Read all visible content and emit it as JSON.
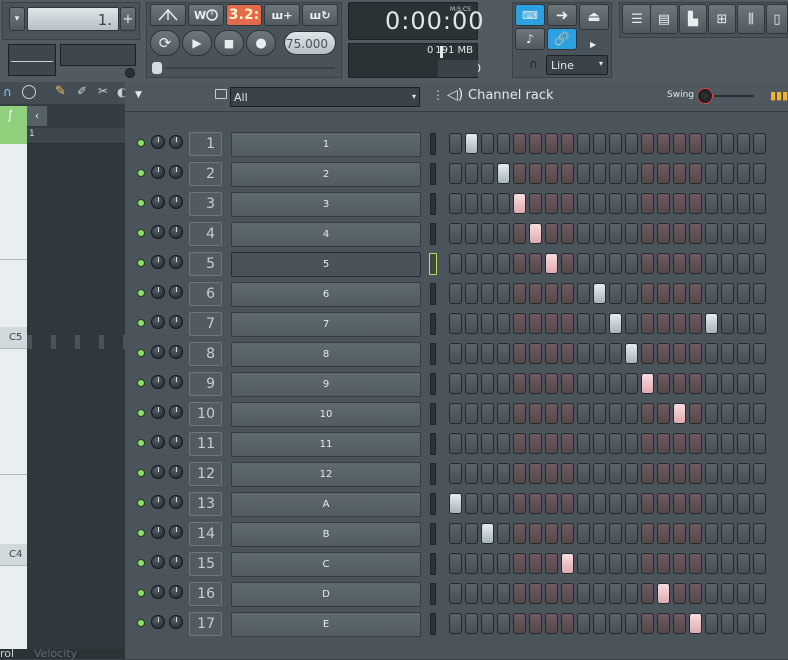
{
  "toolbar": {
    "pattern_value": "1.",
    "tempo": "75.000",
    "time_display": "0:00:00",
    "time_mode_label": "M:S:CS",
    "memory": "191 MB",
    "cpu": "0",
    "polyphony": "0",
    "snap_select": "Line",
    "step_mode_label": "3.2:"
  },
  "browser": {
    "filter": "All"
  },
  "rack": {
    "title": "Channel rack",
    "swing_label": "Swing"
  },
  "piano": {
    "bar_marker": "1",
    "c5": "C5",
    "c4": "C4",
    "bottom_left": "rol",
    "bottom_velocity": "Velocity"
  },
  "channels": [
    {
      "num": "1",
      "name": "1",
      "on_step": 2
    },
    {
      "num": "2",
      "name": "2",
      "on_step": 4
    },
    {
      "num": "3",
      "name": "3",
      "on_step": 5
    },
    {
      "num": "4",
      "name": "4",
      "on_step": 6
    },
    {
      "num": "5",
      "name": "5",
      "on_step": 7
    },
    {
      "num": "6",
      "name": "6",
      "on_step": 10
    },
    {
      "num": "7",
      "name": "7",
      "on_step": 11
    },
    {
      "num": "8",
      "name": "8",
      "on_step": 12
    },
    {
      "num": "9",
      "name": "9",
      "on_step": 13
    },
    {
      "num": "10",
      "name": "10",
      "on_step": 15
    },
    {
      "num": "11",
      "name": "11",
      "on_step": null
    },
    {
      "num": "12",
      "name": "12",
      "on_step": null
    },
    {
      "num": "13",
      "name": "A",
      "on_step": 1
    },
    {
      "num": "14",
      "name": "B",
      "on_step": 3
    },
    {
      "num": "15",
      "name": "C",
      "on_step": 8
    },
    {
      "num": "16",
      "name": "D",
      "on_step": 14
    },
    {
      "num": "17",
      "name": "E",
      "on_step": 16
    }
  ],
  "extra_on_steps": [
    {
      "row": 7,
      "step": 17
    }
  ],
  "selected_channel": 5,
  "colors": {
    "accent_green": "#8be06a",
    "time_bg": "#2a3236",
    "step_red": "#6e5c60",
    "step_grey": "#5a646a"
  }
}
